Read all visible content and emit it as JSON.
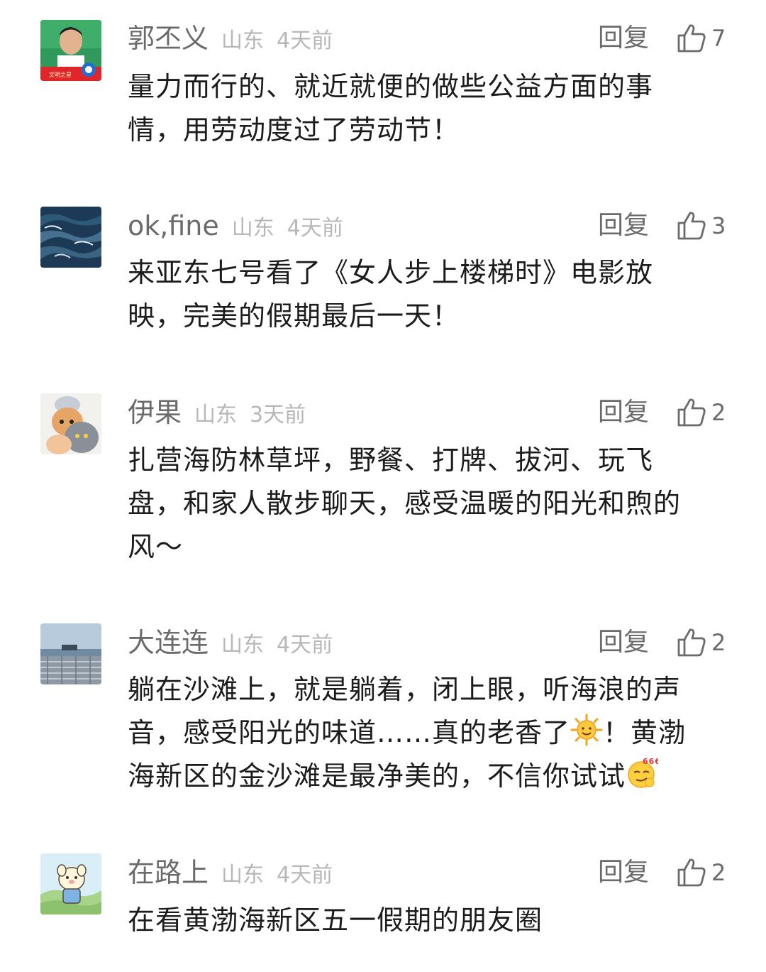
{
  "comments": [
    {
      "username": "郭丕义",
      "region": "山东",
      "time": "4天前",
      "reply_label": "回复",
      "likes": "7",
      "text": "量力而行的、就近就便的做些公益方面的事\n情，用劳动度过了劳动节！",
      "avatar_badge_text": "文明之星"
    },
    {
      "username": "ok,fine",
      "region": "山东",
      "time": "4天前",
      "reply_label": "回复",
      "likes": "3",
      "text": "来亚东七号看了《女人步上楼梯时》电影放\n映，完美的假期最后一天！"
    },
    {
      "username": "伊果",
      "region": "山东",
      "time": "3天前",
      "reply_label": "回复",
      "likes": "2",
      "text": "扎营海防林草坪，野餐、打牌、拔河、玩飞\n盘，和家人散步聊天，感受温暖的阳光和煦的\n风～"
    },
    {
      "username": "大连连",
      "region": "山东",
      "time": "4天前",
      "reply_label": "回复",
      "likes": "2",
      "text_part1": "躺在沙滩上，就是躺着，闭上眼，听海浪的声\n音，感受阳光的味道……真的老香了",
      "text_part2": "！黄渤\n海新区的金沙滩是最净美的，不信你试试",
      "emoji2_text": "666"
    },
    {
      "username": "在路上",
      "region": "山东",
      "time": "4天前",
      "reply_label": "回复",
      "likes": "2",
      "text": "在看黄渤海新区五一假期的朋友圈"
    }
  ],
  "colors": {
    "username": "#6b6b6b",
    "meta": "#b7b7b7",
    "text": "#1c1c1c"
  },
  "icons": {
    "like": "thumbs-up-outline-icon",
    "sun_emoji": "sun-emoji-icon",
    "666_emoji": "smirk-666-emoji-icon"
  }
}
